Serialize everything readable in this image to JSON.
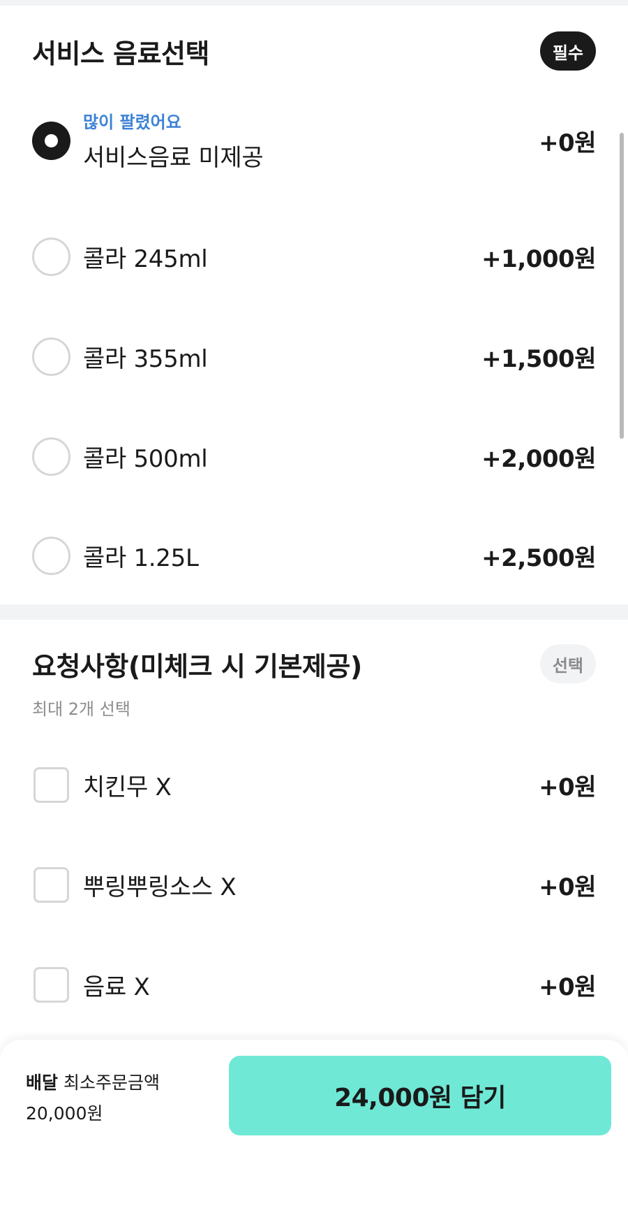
{
  "drink_section": {
    "title": "서비스 음료선택",
    "badge": "필수",
    "options": [
      {
        "tag": "많이 팔렸어요",
        "label": "서비스음료 미제공",
        "price": "+0원",
        "selected": true
      },
      {
        "label": "콜라 245ml",
        "price": "+1,000원",
        "selected": false
      },
      {
        "label": "콜라 355ml",
        "price": "+1,500원",
        "selected": false
      },
      {
        "label": "콜라 500ml",
        "price": "+2,000원",
        "selected": false
      },
      {
        "label": "콜라 1.25L",
        "price": "+2,500원",
        "selected": false
      }
    ]
  },
  "request_section": {
    "title": "요청사항(미체크 시 기본제공)",
    "badge": "선택",
    "subtitle": "최대 2개 선택",
    "options": [
      {
        "label": "치킨무 X",
        "price": "+0원",
        "checked": false
      },
      {
        "label": "뿌링뿌링소스 X",
        "price": "+0원",
        "checked": false
      },
      {
        "label": "음료 X",
        "price": "+0원",
        "checked": false
      }
    ]
  },
  "bottom_bar": {
    "delivery_label": "배달",
    "min_order_label": "최소주문금액",
    "min_order_value": "20,000원",
    "cart_button_label": "24,000원 담기"
  },
  "colors": {
    "accent_button": "#6fe8d6",
    "tag_blue": "#3c82d6",
    "required_badge": "#1a1a1a"
  }
}
